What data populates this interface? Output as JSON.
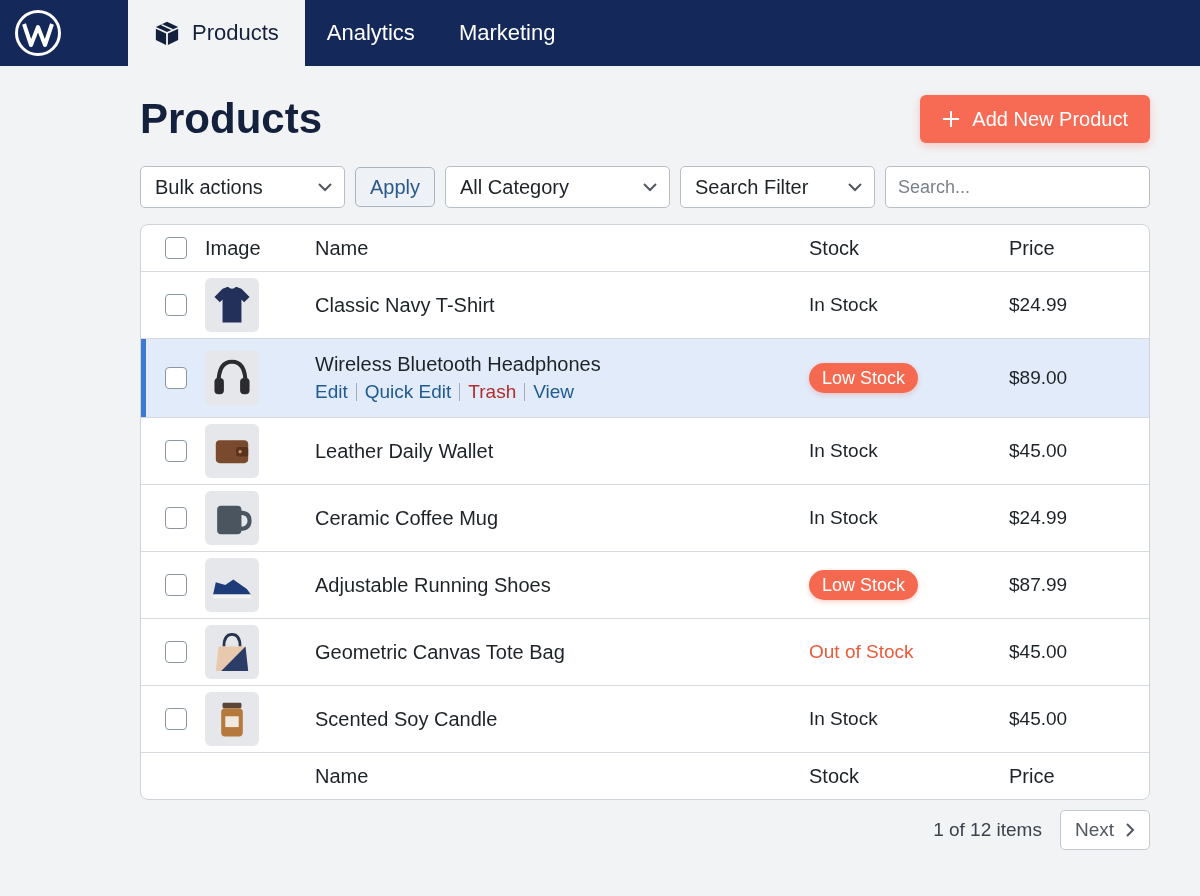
{
  "nav": {
    "tabs": [
      {
        "label": "Products",
        "selected": true,
        "icon": true
      },
      {
        "label": "Analytics",
        "selected": false,
        "icon": false
      },
      {
        "label": "Marketing",
        "selected": false,
        "icon": false
      }
    ]
  },
  "page": {
    "title": "Products",
    "add_button": "Add New Product"
  },
  "toolbar": {
    "bulk_actions": {
      "value": "Bulk actions"
    },
    "apply_button": "Apply",
    "category": {
      "value": "All Category"
    },
    "filter": {
      "value": "Search Filter"
    },
    "search": {
      "placeholder": "Search..."
    }
  },
  "table": {
    "header_checkbox": {
      "checked": false
    },
    "columns": [
      "Image",
      "Name",
      "Stock",
      "Price"
    ],
    "rows": [
      {
        "thumb": {
          "kind": "tshirt"
        },
        "name": "Classic Navy T-Shirt",
        "stock": {
          "text": "In Stock",
          "kind": "plain"
        },
        "price": "$24.99",
        "checked": false,
        "selected": false
      },
      {
        "thumb": {
          "kind": "headphones"
        },
        "name": "Wireless Bluetooth Headphones",
        "actions": [
          {
            "label": "Edit",
            "kind": "link"
          },
          {
            "label": "Quick Edit",
            "kind": "link"
          },
          {
            "label": "Trash",
            "kind": "danger"
          },
          {
            "label": "View",
            "kind": "link"
          }
        ],
        "stock": {
          "text": "Low Stock",
          "kind": "badge"
        },
        "price": "$89.00",
        "checked": false,
        "selected": true
      },
      {
        "thumb": {
          "kind": "wallet"
        },
        "name": "Leather Daily Wallet",
        "stock": {
          "text": "In Stock",
          "kind": "plain"
        },
        "price": "$45.00",
        "checked": false,
        "selected": false
      },
      {
        "thumb": {
          "kind": "mug"
        },
        "name": "Ceramic Coffee Mug",
        "stock": {
          "text": "In Stock",
          "kind": "plain"
        },
        "price": "$24.99",
        "checked": false,
        "selected": false
      },
      {
        "thumb": {
          "kind": "shoe"
        },
        "name": "Adjustable Running Shoes",
        "stock": {
          "text": "Low Stock",
          "kind": "badge"
        },
        "price": "$87.99",
        "checked": false,
        "selected": false
      },
      {
        "thumb": {
          "kind": "tote"
        },
        "name": "Geometric Canvas Tote Bag",
        "stock": {
          "text": "Out of Stock",
          "kind": "alert"
        },
        "price": "$45.00",
        "checked": false,
        "selected": false
      },
      {
        "thumb": {
          "kind": "candle"
        },
        "name": "Scented Soy Candle",
        "stock": {
          "text": "In Stock",
          "kind": "plain"
        },
        "price": "$45.00",
        "checked": false,
        "selected": false
      }
    ],
    "footer_columns": [
      "Name",
      "Stock",
      "Price"
    ]
  },
  "pagination": {
    "summary": "1 of 12 items",
    "next_button": "Next"
  }
}
